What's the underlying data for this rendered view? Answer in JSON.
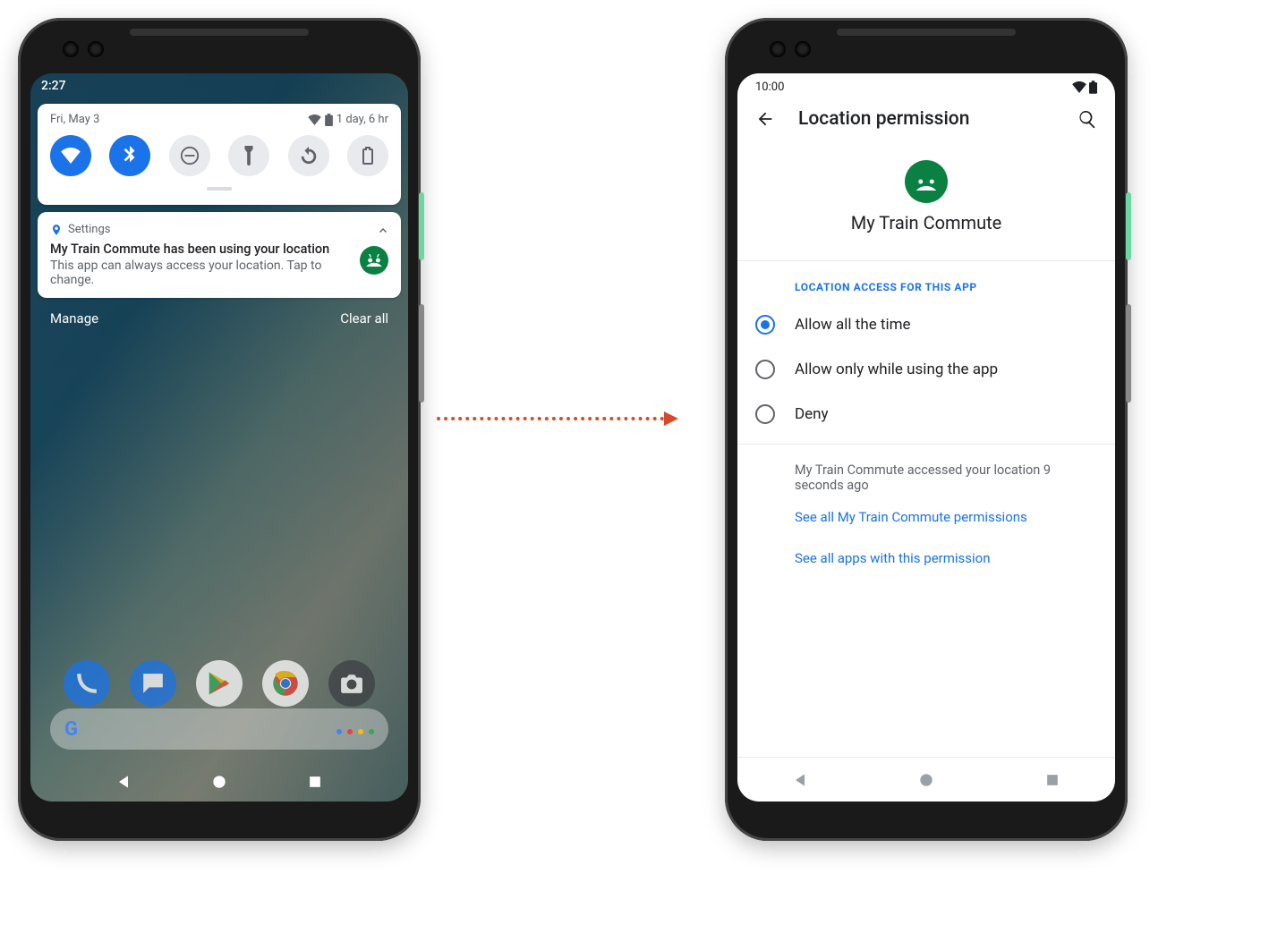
{
  "left": {
    "status_time": "2:27",
    "qs": {
      "date": "Fri, May 3",
      "battery_text": "1 day, 6 hr",
      "tiles": [
        {
          "name": "wifi",
          "on": true
        },
        {
          "name": "bluetooth",
          "on": true
        },
        {
          "name": "dnd",
          "on": false
        },
        {
          "name": "flashlight",
          "on": false
        },
        {
          "name": "rotate",
          "on": false
        },
        {
          "name": "battery",
          "on": false
        }
      ]
    },
    "notification": {
      "source": "Settings",
      "title": "My Train Commute has been using your location",
      "body": "This app can always access your location. Tap to change."
    },
    "actions": {
      "manage": "Manage",
      "clear": "Clear all"
    }
  },
  "right": {
    "status_time": "10:00",
    "title": "Location permission",
    "app_name": "My Train Commute",
    "section_header": "LOCATION ACCESS FOR THIS APP",
    "options": [
      {
        "label": "Allow all the time",
        "selected": true
      },
      {
        "label": "Allow only while using the app",
        "selected": false
      },
      {
        "label": "Deny",
        "selected": false
      }
    ],
    "access_info": "My Train Commute accessed your location 9 seconds ago",
    "link_all_perms": "See all My Train Commute permissions",
    "link_all_apps": "See all apps with this permission"
  }
}
